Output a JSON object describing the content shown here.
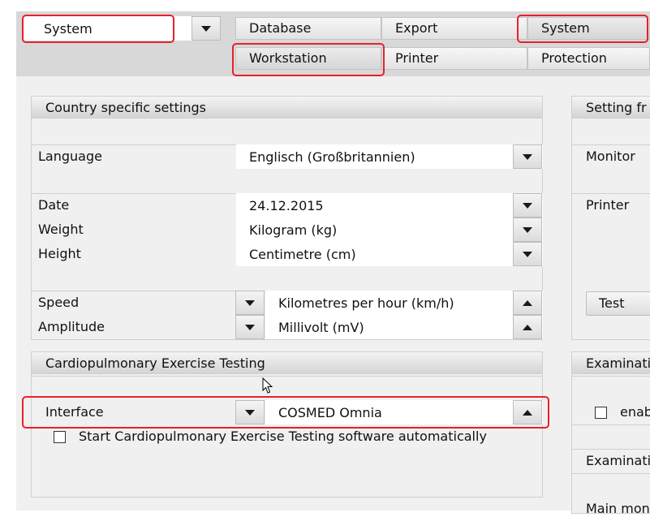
{
  "top_dropdown": {
    "value": "System"
  },
  "tabs_row1": [
    {
      "label": "Database"
    },
    {
      "label": "Export"
    },
    {
      "label": "System"
    }
  ],
  "tabs_row2": [
    {
      "label": "Workstation"
    },
    {
      "label": "Printer"
    },
    {
      "label": "Protection"
    }
  ],
  "country": {
    "title": "Country specific settings",
    "language": {
      "label": "Language",
      "value": "Englisch (Großbritannien)"
    },
    "date": {
      "label": "Date",
      "value": "24.12.2015"
    },
    "weight": {
      "label": "Weight",
      "value": "Kilogram (kg)"
    },
    "height": {
      "label": "Height",
      "value": "Centimetre (cm)"
    },
    "speed": {
      "label": "Speed",
      "value": "Kilometres per hour (km/h)"
    },
    "amplitude": {
      "label": "Amplitude",
      "value": "Millivolt (mV)"
    }
  },
  "cpet": {
    "title": "Cardiopulmonary Exercise Testing",
    "interface": {
      "label": "Interface",
      "value": "COSMED Omnia"
    },
    "autostart_label": "Start Cardiopulmonary Exercise Testing software automatically"
  },
  "right_panel": {
    "title": "Setting fr",
    "monitor_label": "Monitor",
    "printer_label": "Printer",
    "test_button": "Test"
  },
  "exam_panel": {
    "title": "Examinati",
    "checkbox_label": "enab",
    "row_label": "Examinati",
    "main_label": "Main mon"
  },
  "colors": {
    "highlight": "#e8202a",
    "panel_bg": "#f0f0f0",
    "frame_bg": "#d8d8d8"
  }
}
